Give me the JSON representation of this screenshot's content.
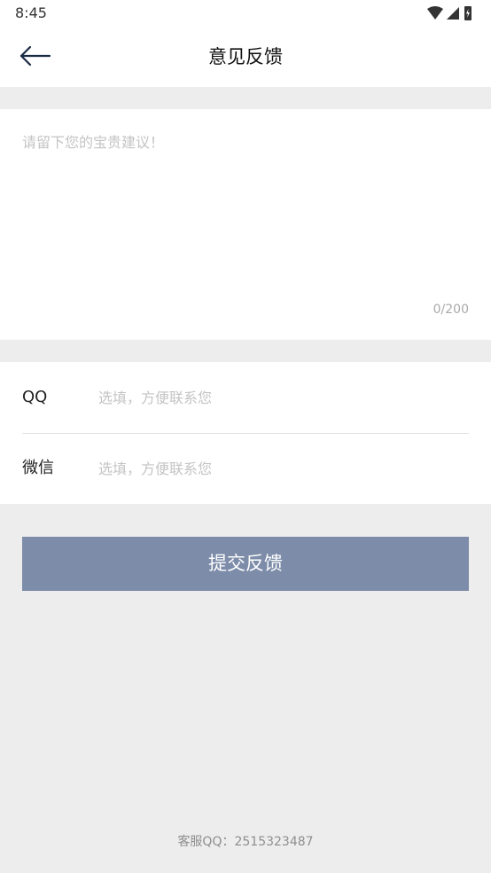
{
  "status_bar": {
    "time": "8:45",
    "icons": [
      "wifi-icon",
      "signal-icon",
      "battery-icon"
    ]
  },
  "header": {
    "back_icon": "arrow-left-icon",
    "title": "意见反馈"
  },
  "feedback": {
    "placeholder": "请留下您的宝贵建议！",
    "value": "",
    "counter": "0/200"
  },
  "contact": {
    "qq_label": "QQ",
    "qq_placeholder": "选填，方便联系您",
    "wechat_label": "微信",
    "wechat_placeholder": "选填，方便联系您"
  },
  "submit": {
    "label": "提交反馈"
  },
  "footer": {
    "service_label": "客服QQ：",
    "service_number": "2515323487"
  },
  "colors": {
    "page_background": "#ededed",
    "card_background": "#ffffff",
    "submit_button": "#7d8ca9",
    "placeholder_text": "#c4c4c4"
  }
}
